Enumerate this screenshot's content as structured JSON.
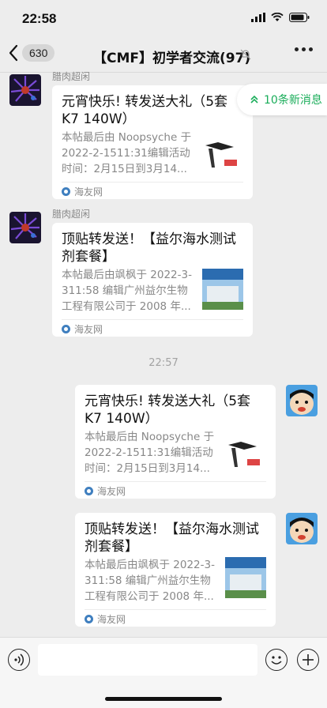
{
  "status": {
    "time": "22:58"
  },
  "nav": {
    "back_count": "630",
    "title": "【CMF】初学者交流(97)"
  },
  "new_messages": {
    "label": "10条新消息"
  },
  "messages": [
    {
      "sender": "腊肉超闲",
      "title": "元宵快乐! 转发送大礼（5套K7 140W）",
      "desc": "本帖最后由 Noopsyche 于 2022-2-1511:31编辑活动时间：2月15日到3月14...",
      "source": "海友网"
    },
    {
      "sender": "腊肉超闲",
      "title": "顶贴转发送！【益尔海水测试剂套餐】",
      "desc": "本帖最后由飒枫于 2022-3-311:58 编辑广州益尔生物工程有限公司于 2008 年...",
      "source": "海友网"
    }
  ],
  "time_separator": "22:57",
  "my_messages": [
    {
      "title": "元宵快乐! 转发送大礼（5套K7 140W）",
      "desc": "本帖最后由 Noopsyche 于 2022-2-1511:31编辑活动时间：2月15日到3月14...",
      "source": "海友网"
    },
    {
      "title": "顶贴转发送！【益尔海水测试剂套餐】",
      "desc": "本帖最后由飒枫于 2022-3-311:58 编辑广州益尔生物工程有限公司于 2008 年...",
      "source": "海友网"
    }
  ],
  "input": {
    "value": "",
    "placeholder": ""
  },
  "colors": {
    "accent_green": "#1aad5a",
    "background": "#ededed"
  }
}
